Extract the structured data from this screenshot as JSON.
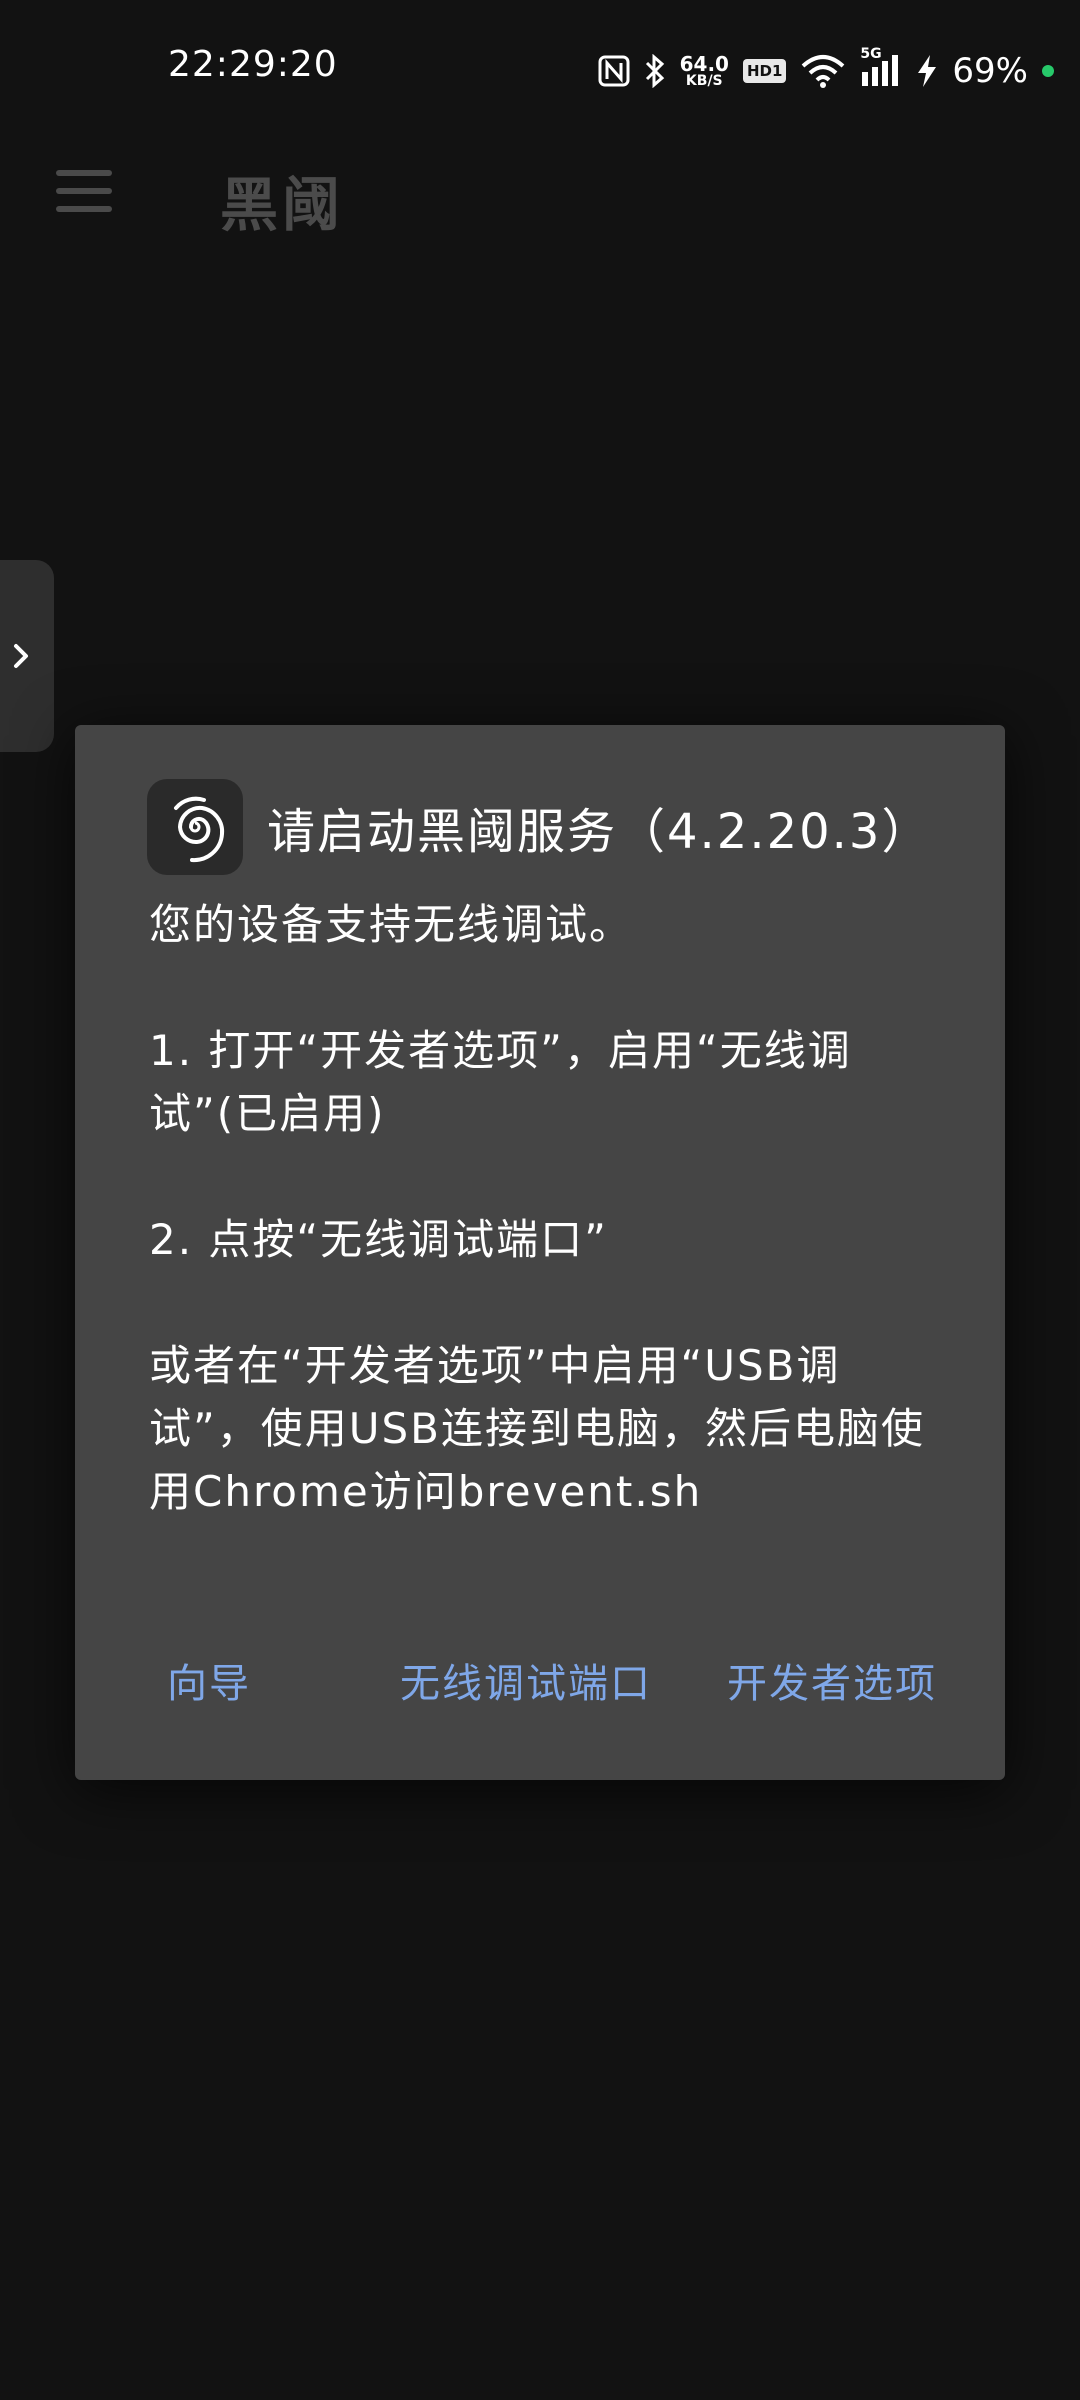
{
  "status_bar": {
    "time": "22:29:20",
    "net_speed_value": "64.0",
    "net_speed_unit": "KB/S",
    "hd_label": "HD1",
    "signal_label": "5G",
    "battery_percent": "69%",
    "icons": [
      "nfc-icon",
      "bluetooth-icon",
      "wifi-icon",
      "cellular-signal-icon",
      "charging-icon"
    ],
    "battery_dot_color": "#27c96a"
  },
  "app_bar": {
    "title": "黑阈",
    "menu_icon": "hamburger-menu-icon"
  },
  "side_handle": {
    "icon": "chevron-right-icon"
  },
  "dialog": {
    "title": "请启动黑阈服务（4.2.20.3）",
    "logo_icon": "brevent-swirl-logo-icon",
    "body": [
      "您的设备支持无线调试。",
      "1. 打开“开发者选项”，启用“无线调试”(已启用)",
      "2. 点按“无线调试端口”",
      "或者在“开发者选项”中启用“USB调试”，使用USB连接到电脑，然后电脑使用Chrome访问brevent.sh"
    ],
    "actions": {
      "guide": "向导",
      "wireless_port": "无线调试端口",
      "developer_options": "开发者选项"
    },
    "accent_color": "#7fa7e8",
    "background_color": "#454545"
  }
}
